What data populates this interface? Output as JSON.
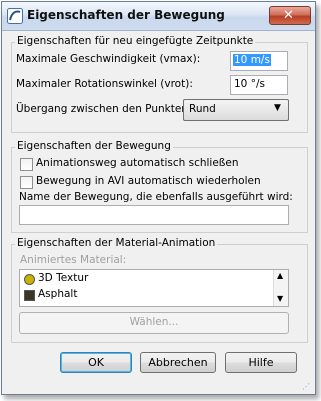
{
  "window": {
    "title": "Eigenschaften der Bewegung"
  },
  "new_points": {
    "group_title": "Eigenschaften für neu eingefügte Zeitpunkte",
    "max_speed_label": "Maximale Geschwindigkeit (vmax):",
    "max_speed_value": "10 m/s",
    "max_rotation_label": "Maximaler Rotationswinkel (vrot):",
    "max_rotation_value": "10 °/s",
    "transition_label": "Übergang zwischen den Punkten:",
    "transition_value": "Rund"
  },
  "motion": {
    "group_title": "Eigenschaften der Bewegung",
    "close_path_label": "Animationsweg automatisch schließen",
    "repeat_avi_label": "Bewegung in AVI automatisch wiederholen",
    "also_run_label": "Name der Bewegung, die ebenfalls ausgeführt wird:",
    "also_run_value": ""
  },
  "material": {
    "group_title": "Eigenschaften der Material-Animation",
    "animated_label": "Animiertes Material:",
    "items": [
      {
        "label": "3D Textur",
        "color": "#c8b400"
      },
      {
        "label": "Asphalt",
        "color": "#3a3524"
      }
    ],
    "choose_label": "Wählen..."
  },
  "buttons": {
    "ok": "OK",
    "cancel": "Abbrechen",
    "help": "Hilfe"
  },
  "colors": {
    "accent": "#3399ff",
    "title_gradient_top": "#f4f8fd",
    "close_red": "#c1452a"
  }
}
